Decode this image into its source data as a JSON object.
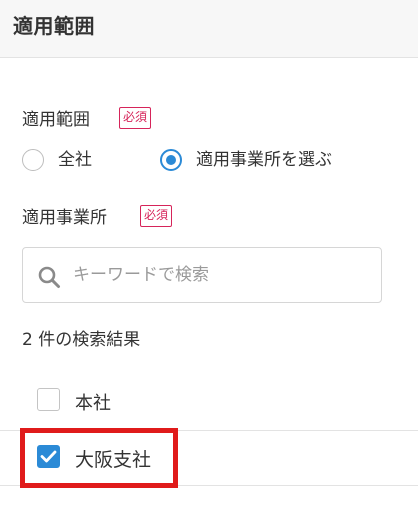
{
  "panel": {
    "title": "適用範囲"
  },
  "scope_field": {
    "label": "適用範囲",
    "required": "必須",
    "options": [
      {
        "label": "全社",
        "selected": false
      },
      {
        "label": "適用事業所を選ぶ",
        "selected": true
      }
    ]
  },
  "office_field": {
    "label": "適用事業所",
    "required": "必須"
  },
  "search": {
    "placeholder": "キーワードで検索",
    "value": ""
  },
  "results": {
    "count_text": "2 件の検索結果",
    "items": [
      {
        "label": "本社",
        "checked": false
      },
      {
        "label": "大阪支社",
        "checked": true
      }
    ]
  },
  "colors": {
    "accent": "#2b8ad6",
    "required": "#d6245a",
    "highlight": "#e01b1b"
  }
}
